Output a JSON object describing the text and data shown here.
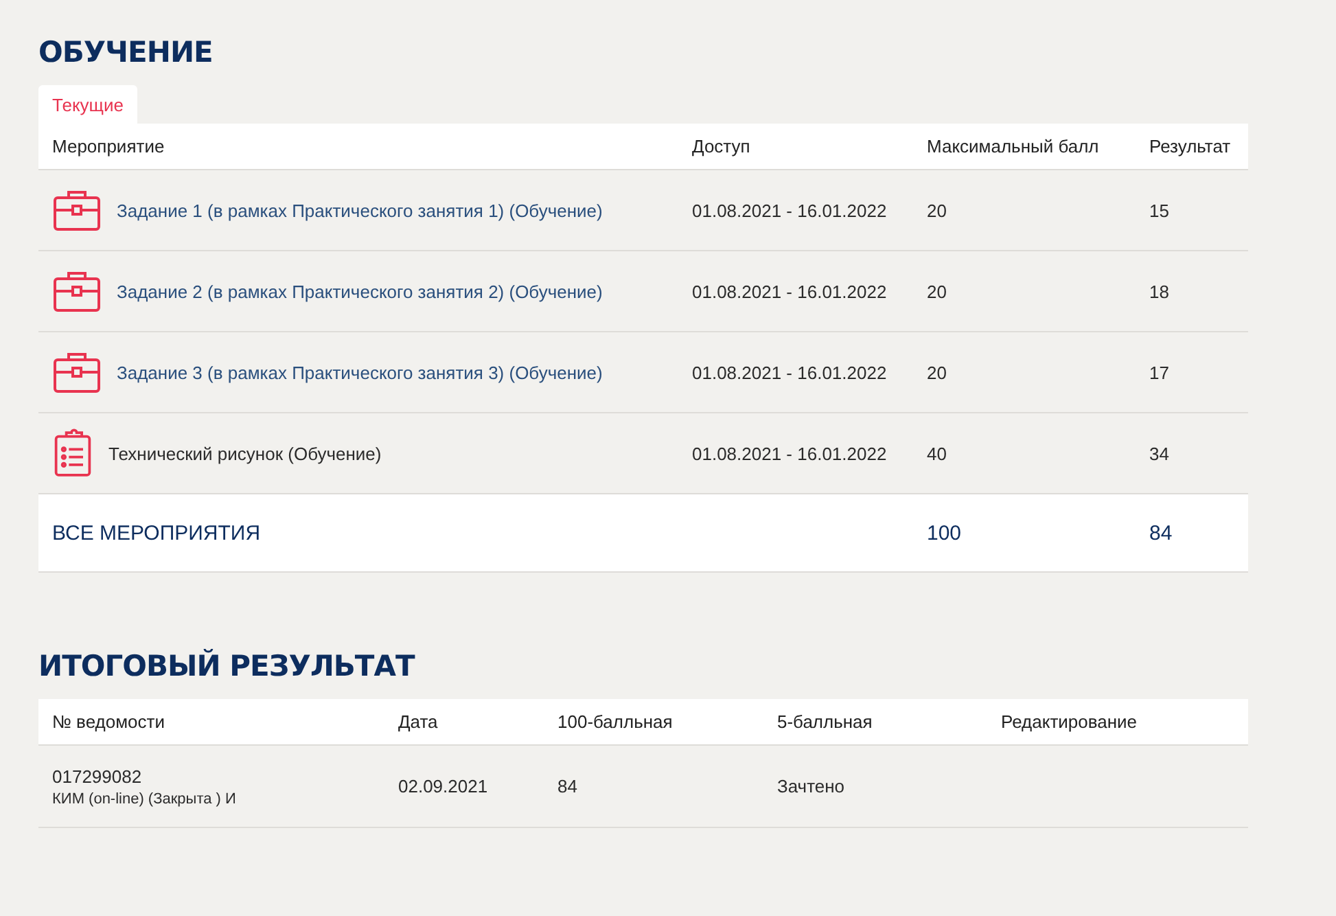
{
  "learning": {
    "title": "ОБУЧЕНИЕ",
    "tabs": [
      {
        "label": "Текущие",
        "selected": true
      }
    ],
    "columns": [
      "Мероприятие",
      "Доступ",
      "Максимальный балл",
      "Результат"
    ],
    "rows": [
      {
        "kind": "briefcase",
        "linked": true,
        "name": "Задание 1 (в рамках Практического занятия 1) (Обучение)",
        "access": "01.08.2021 - 16.01.2022",
        "max": "20",
        "result": "15"
      },
      {
        "kind": "briefcase",
        "linked": true,
        "name": "Задание 2 (в рамках Практического занятия 2) (Обучение)",
        "access": "01.08.2021 - 16.01.2022",
        "max": "20",
        "result": "18"
      },
      {
        "kind": "briefcase",
        "linked": true,
        "name": "Задание 3 (в рамках Практического занятия 3) (Обучение)",
        "access": "01.08.2021 - 16.01.2022",
        "max": "20",
        "result": "17"
      },
      {
        "kind": "clipboard",
        "linked": false,
        "name": "Технический рисунок (Обучение)",
        "access": "01.08.2021 - 16.01.2022",
        "max": "40",
        "result": "34"
      }
    ],
    "total": {
      "label": "ВСЕ МЕРОПРИЯТИЯ",
      "max": "100",
      "result": "84"
    }
  },
  "final": {
    "title": "ИТОГОВЫЙ РЕЗУЛЬТАТ",
    "columns": [
      "№ ведомости",
      "Дата",
      "100-балльная",
      "5-балльная",
      "Редактирование"
    ],
    "rows": [
      {
        "number": "017299082",
        "note": "КИМ (on-line) (Закрыта ) И",
        "date": "02.09.2021",
        "score100": "84",
        "score5": "Зачтено"
      }
    ]
  }
}
